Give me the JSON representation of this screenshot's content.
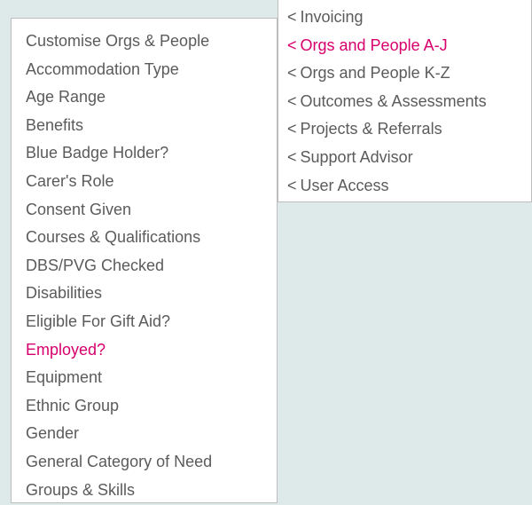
{
  "right_menu": {
    "items": [
      {
        "label": "Invoicing",
        "active": false
      },
      {
        "label": "Orgs and People A-J",
        "active": true
      },
      {
        "label": "Orgs and People K-Z",
        "active": false
      },
      {
        "label": "Outcomes & Assessments",
        "active": false
      },
      {
        "label": "Projects & Referrals",
        "active": false
      },
      {
        "label": "Support Advisor",
        "active": false
      },
      {
        "label": "User Access",
        "active": false
      }
    ]
  },
  "left_menu": {
    "items": [
      {
        "label": "Customise Orgs & People",
        "active": false
      },
      {
        "label": "Accommodation Type",
        "active": false
      },
      {
        "label": "Age Range",
        "active": false
      },
      {
        "label": "Benefits",
        "active": false
      },
      {
        "label": "Blue Badge Holder?",
        "active": false
      },
      {
        "label": "Carer's Role",
        "active": false
      },
      {
        "label": "Consent Given",
        "active": false
      },
      {
        "label": "Courses & Qualifications",
        "active": false
      },
      {
        "label": "DBS/PVG Checked",
        "active": false
      },
      {
        "label": "Disabilities",
        "active": false
      },
      {
        "label": "Eligible For Gift Aid?",
        "active": false
      },
      {
        "label": "Employed?",
        "active": true
      },
      {
        "label": "Equipment",
        "active": false
      },
      {
        "label": "Ethnic Group",
        "active": false
      },
      {
        "label": "Gender",
        "active": false
      },
      {
        "label": "General Category of Need",
        "active": false
      },
      {
        "label": "Groups & Skills",
        "active": false
      }
    ]
  },
  "colors": {
    "accent": "#d6006c",
    "text": "#5b5b5b",
    "background": "#dee9e9",
    "panel": "#ffffff",
    "border": "#bdbdbd"
  }
}
